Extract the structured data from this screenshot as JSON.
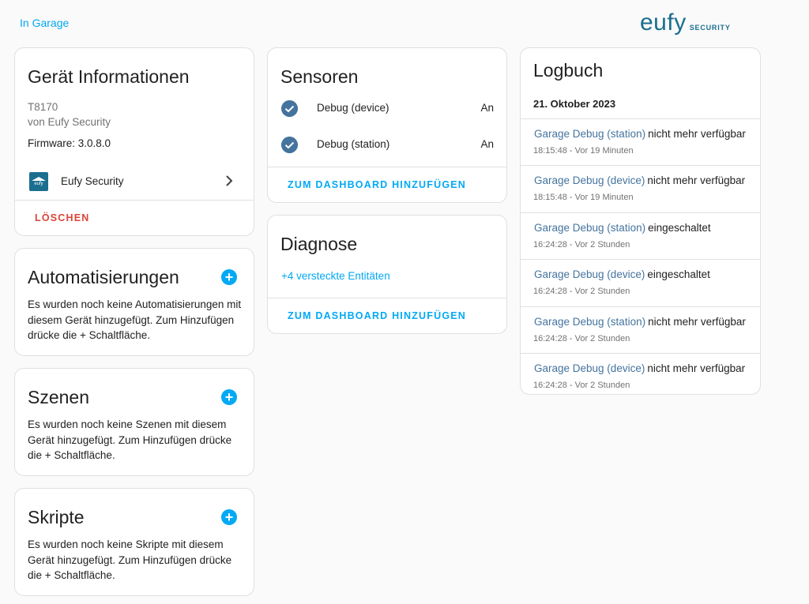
{
  "header": {
    "back_link": "In Garage",
    "brand_word": "eufy",
    "brand_sub": "SECURITY"
  },
  "device_info": {
    "title": "Gerät Informationen",
    "model": "T8170",
    "manufacturer": "von Eufy Security",
    "firmware": "Firmware: 3.0.8.0",
    "integration_logo_text": "eufy",
    "integration_name": "Eufy Security",
    "delete_label": "LÖSCHEN"
  },
  "automations": {
    "title": "Automatisierungen",
    "text": "Es wurden noch keine Automatisierungen mit diesem Gerät hinzugefügt. Zum Hinzufügen drücke die + Schaltfläche."
  },
  "scenes": {
    "title": "Szenen",
    "text": "Es wurden noch keine Szenen mit diesem Gerät hinzugefügt. Zum Hinzufügen drücke die + Schaltfläche."
  },
  "scripts": {
    "title": "Skripte",
    "text": "Es wurden noch keine Skripte mit diesem Gerät hinzugefügt. Zum Hinzufügen drücke die + Schaltfläche."
  },
  "sensors": {
    "title": "Sensoren",
    "items": [
      {
        "name": "Debug (device)",
        "state": "An"
      },
      {
        "name": "Debug (station)",
        "state": "An"
      }
    ],
    "add_to_dashboard": "ZUM DASHBOARD HINZUFÜGEN"
  },
  "diagnose": {
    "title": "Diagnose",
    "hidden_entities": "+4 versteckte Entitäten",
    "add_to_dashboard": "ZUM DASHBOARD HINZUFÜGEN"
  },
  "logbook": {
    "title": "Logbuch",
    "date": "21. Oktober 2023",
    "entries": [
      {
        "entity": "Garage Debug (station)",
        "message": "nicht mehr verfügbar",
        "time": "18:15:48 - Vor 19 Minuten"
      },
      {
        "entity": "Garage Debug (device)",
        "message": "nicht mehr verfügbar",
        "time": "18:15:48 - Vor 19 Minuten"
      },
      {
        "entity": "Garage Debug (station)",
        "message": "eingeschaltet",
        "time": "16:24:28 - Vor 2 Stunden"
      },
      {
        "entity": "Garage Debug (device)",
        "message": "eingeschaltet",
        "time": "16:24:28 - Vor 2 Stunden"
      },
      {
        "entity": "Garage Debug (station)",
        "message": "nicht mehr verfügbar",
        "time": "16:24:28 - Vor 2 Stunden"
      },
      {
        "entity": "Garage Debug (device)",
        "message": "nicht mehr verfügbar",
        "time": "16:24:28 - Vor 2 Stunden"
      }
    ]
  },
  "colors": {
    "accent": "#03a9f4",
    "entity_blue": "#44739e",
    "danger": "#db4437",
    "brand": "#1a6e8e"
  },
  "icons": {
    "check": "check-circle-icon",
    "plus": "plus-circle-icon",
    "chevron": "chevron-right-icon"
  }
}
